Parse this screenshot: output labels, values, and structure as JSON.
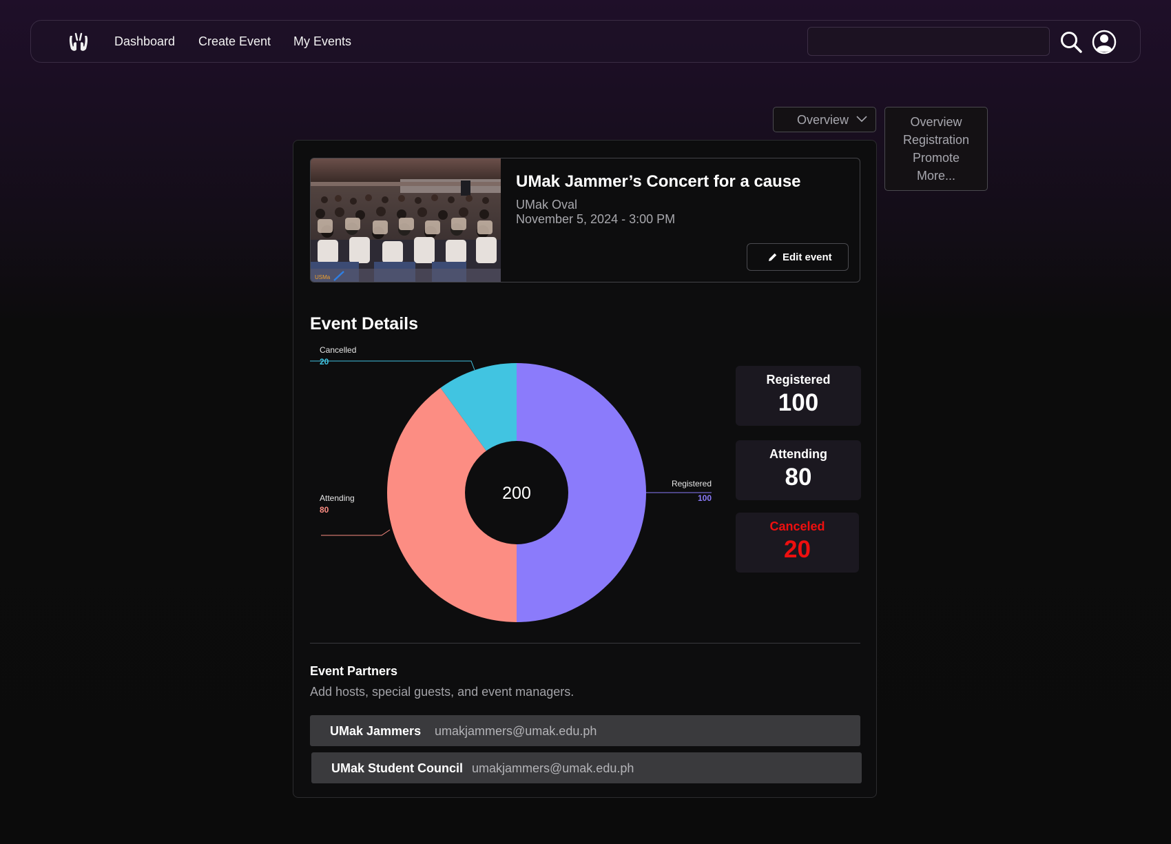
{
  "nav": {
    "links": [
      "Dashboard",
      "Create Event",
      "My Events"
    ],
    "search_value": ""
  },
  "view_select": {
    "selected": "Overview",
    "options": [
      "Overview",
      "Registration",
      "Promote",
      "More..."
    ]
  },
  "event": {
    "title": "UMak Jammer’s Concert for a cause",
    "venue": "UMak Oval",
    "datetime": "November 5, 2024 - 3:00 PM",
    "edit_label": "Edit event",
    "photo_watermark": "USMa"
  },
  "details": {
    "title": "Event Details"
  },
  "chart_data": {
    "type": "pie",
    "donut": true,
    "center_label": "200",
    "slices": [
      {
        "label": "Registered",
        "value": 100,
        "color": "#8b7bfb"
      },
      {
        "label": "Attending",
        "value": 80,
        "color": "#fc8d83"
      },
      {
        "label": "Cancelled",
        "value": 20,
        "color": "#41c4e1"
      }
    ]
  },
  "stats": [
    {
      "label": "Registered",
      "value": "100",
      "color": "#ffffff"
    },
    {
      "label": "Attending",
      "value": "80",
      "color": "#ffffff"
    },
    {
      "label": "Canceled",
      "value": "20",
      "color": "#ee0f0f"
    }
  ],
  "partners": {
    "title": "Event Partners",
    "description": "Add hosts, special guests, and event managers.",
    "list": [
      {
        "name": "UMak Jammers",
        "email": "umakjammers@umak.edu.ph"
      },
      {
        "name": "UMak Student Council",
        "email": "umakjammers@umak.edu.ph"
      }
    ]
  },
  "icons": {
    "logo": "hands-logo-icon",
    "search": "search-icon",
    "avatar": "user-avatar-icon",
    "chevron": "chevron-down-icon",
    "edit": "pencil-icon"
  }
}
